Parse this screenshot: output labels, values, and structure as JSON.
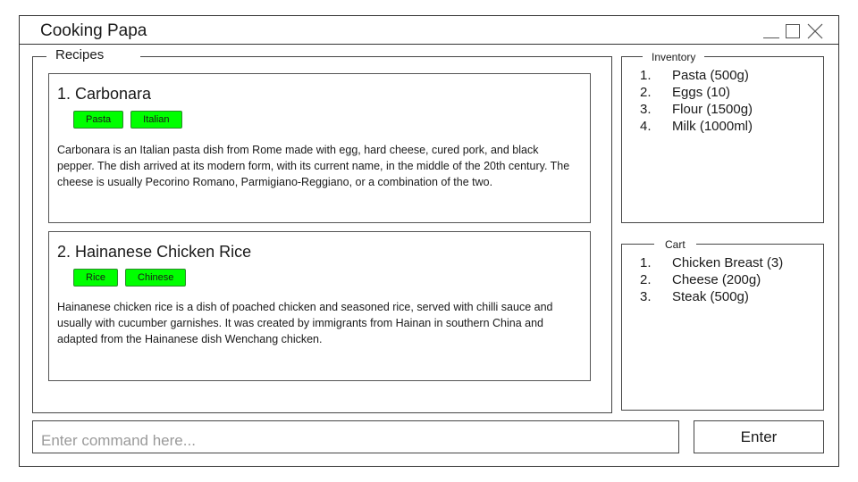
{
  "window": {
    "title": "Cooking Papa",
    "controls": [
      "minimize-icon",
      "maximize-icon",
      "close-icon"
    ]
  },
  "recipes": {
    "legend": "Recipes",
    "items": [
      {
        "title": "1. Carbonara",
        "tags": [
          "Pasta",
          "Italian"
        ],
        "description": "Carbonara is an Italian pasta dish from Rome made with egg, hard cheese, cured pork, and black pepper. The dish arrived at its modern form, with its current name, in the middle of the 20th century. The cheese is usually Pecorino Romano, Parmigiano-Reggiano, or a combination of the two."
      },
      {
        "title": "2. Hainanese Chicken Rice",
        "tags": [
          "Rice",
          "Chinese"
        ],
        "description": "Hainanese chicken rice is a dish of poached chicken and seasoned rice, served with chilli sauce and usually with cucumber garnishes. It was created by immigrants from Hainan in southern China and adapted from the Hainanese dish Wenchang chicken."
      }
    ]
  },
  "inventory": {
    "legend": "Inventory",
    "items": [
      {
        "num": "1.",
        "label": "Pasta (500g)"
      },
      {
        "num": "2.",
        "label": "Eggs (10)"
      },
      {
        "num": "3.",
        "label": "Flour (1500g)"
      },
      {
        "num": "4.",
        "label": "Milk (1000ml)"
      }
    ]
  },
  "cart": {
    "legend": "Cart",
    "items": [
      {
        "num": "1.",
        "label": "Chicken Breast (3)"
      },
      {
        "num": "2.",
        "label": "Cheese (200g)"
      },
      {
        "num": "3.",
        "label": "Steak (500g)"
      }
    ]
  },
  "command": {
    "placeholder": "Enter command here...",
    "value": "",
    "enter_label": "Enter"
  },
  "colors": {
    "tag_bg": "#00ff00",
    "border": "#444444",
    "placeholder": "#9a9a9a"
  }
}
